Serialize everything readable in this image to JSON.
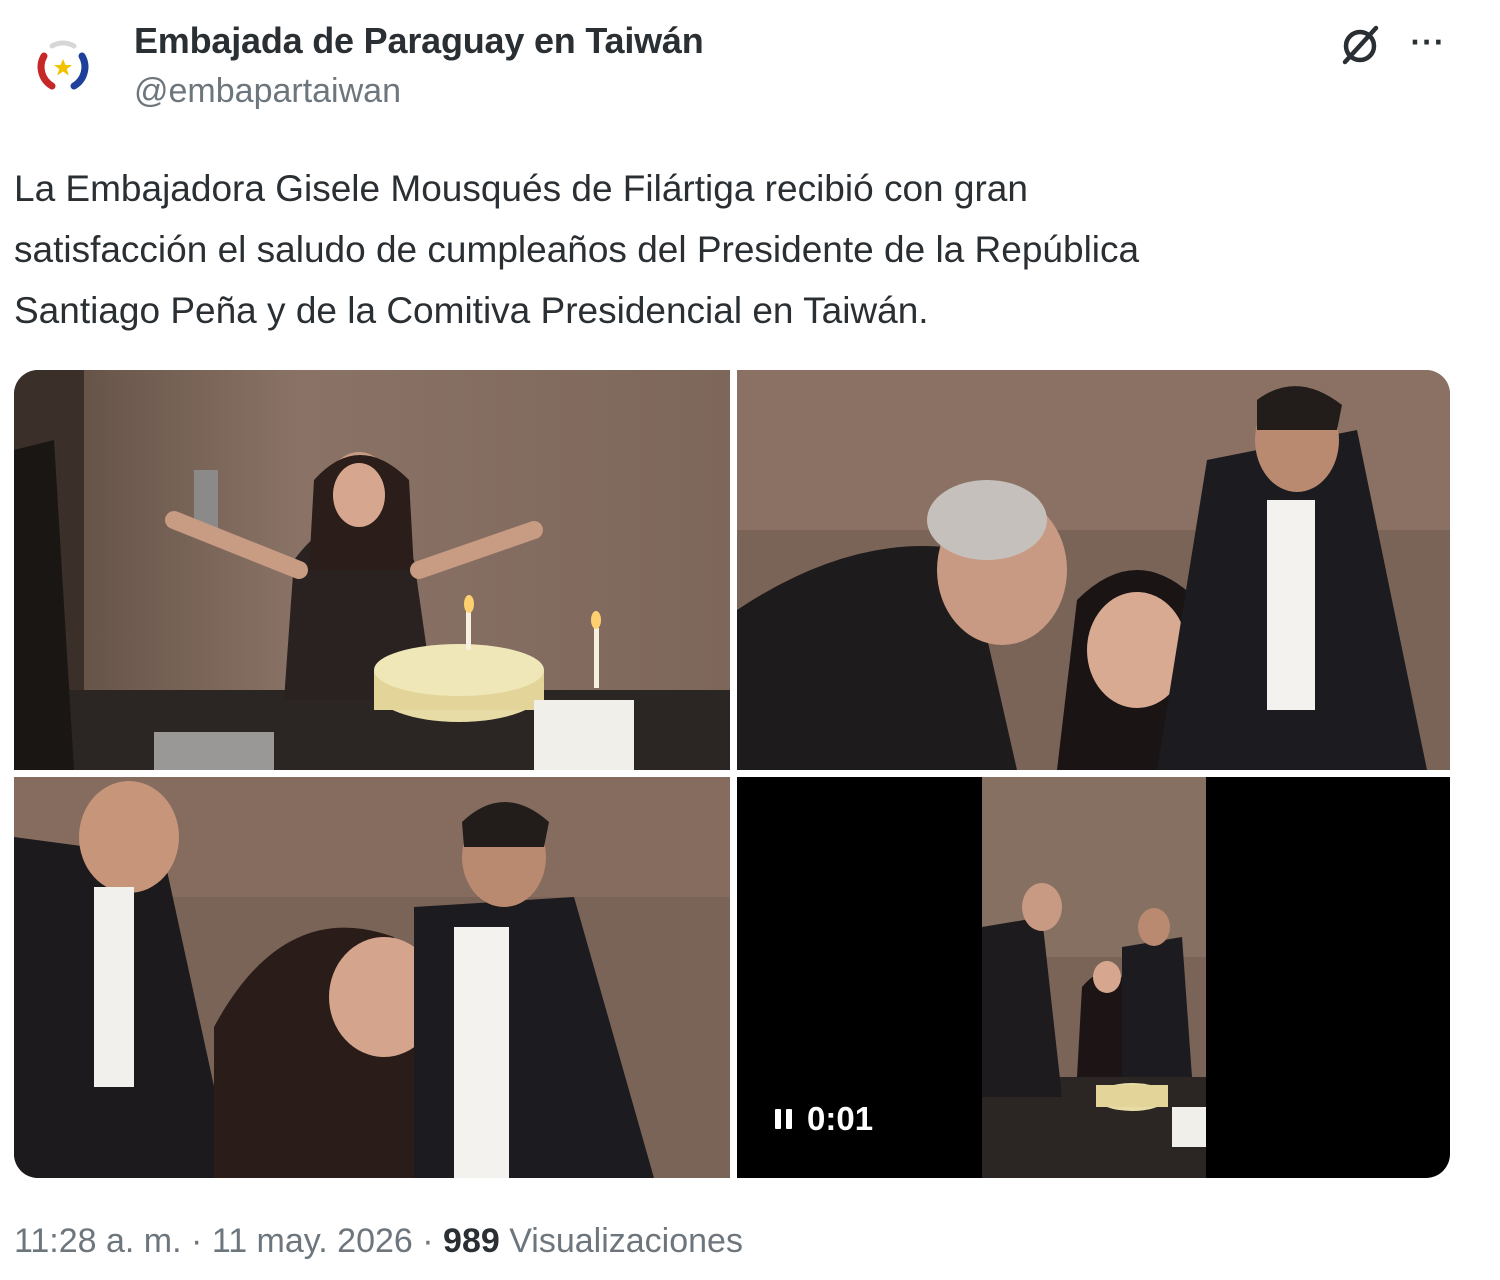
{
  "author": {
    "name": "Embajada de Paraguay en Taiwán",
    "handle": "@embapartaiwan"
  },
  "tweet": {
    "text": "La Embajadora Gisele Mousqués de Filártiga recibió con gran\nsatisfacción el saludo de cumpleaños del Presidente de la República\nSantiago Peña y de la Comitiva Presidencial en Taiwán."
  },
  "media": {
    "count": 4,
    "video_time": "0:01"
  },
  "meta": {
    "time": "11:28 a. m.",
    "separator": "·",
    "date": "11 may. 2026",
    "views_count": "989",
    "views_label": "Visualizaciones"
  },
  "icons": {
    "grok": "grok-icon",
    "more": "more-icon",
    "pause": "pause-icon"
  },
  "colors": {
    "text": "#2a2f33",
    "secondary": "#6e767d",
    "background": "#ffffff"
  }
}
